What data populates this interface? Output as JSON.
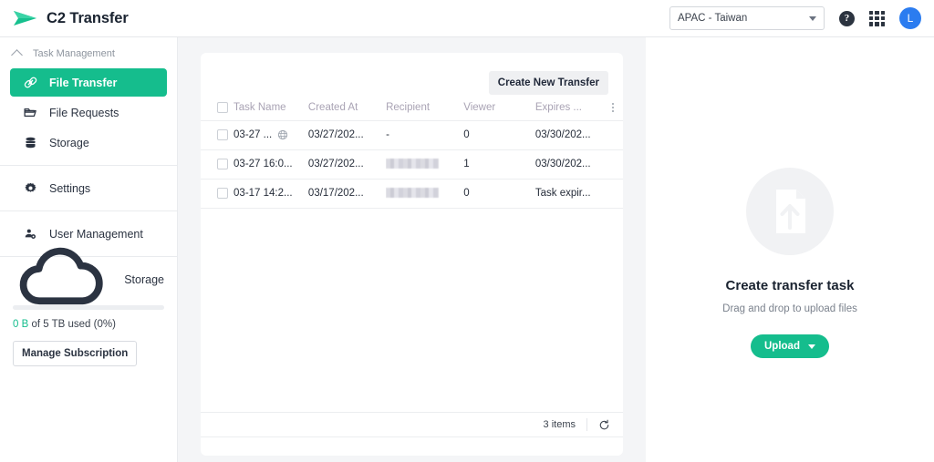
{
  "topbar": {
    "brand_title": "C2 Transfer",
    "logo_icon": "paper-plane-icon",
    "region_value": "APAC - Taiwan",
    "help_glyph": "?",
    "help_icon": "help-circle-icon",
    "apps_icon": "apps-grid-icon",
    "avatar_initial": "L",
    "avatar_color": "#2b7cf0"
  },
  "sidebar": {
    "group_label": "Task Management",
    "group_chevron": "chevron-up-icon",
    "items": [
      {
        "label": "File Transfer",
        "icon": "link-icon",
        "active": true
      },
      {
        "label": "File Requests",
        "icon": "folder-icon",
        "active": false
      },
      {
        "label": "Storage",
        "icon": "database-icon",
        "active": false
      },
      {
        "label": "Settings",
        "icon": "gear-icon",
        "active": false
      },
      {
        "label": "User Management",
        "icon": "user-settings-icon",
        "active": false
      }
    ],
    "storage": {
      "label": "Storage",
      "icon": "cloud-icon",
      "used_value": "0 B",
      "usage_rest": " of 5 TB used (0%)",
      "percent": 0,
      "manage_label": "Manage Subscription"
    },
    "accent_color": "#15bd8d"
  },
  "main": {
    "create_button": "Create New Transfer",
    "columns": [
      "",
      "Task Name",
      "Created At",
      "Recipient",
      "Viewer",
      "Expires ...",
      ""
    ],
    "menu_icon": "kebab-menu-icon",
    "rows": [
      {
        "name": "03-27 ...",
        "name_icon": "globe-icon",
        "has_icon": true,
        "created": "03/27/202...",
        "recipient": "-",
        "recipient_redacted": false,
        "viewer": "0",
        "expires": "03/30/202..."
      },
      {
        "name": "03-27 16:0...",
        "has_icon": false,
        "created": "03/27/202...",
        "recipient": "",
        "recipient_redacted": true,
        "viewer": "1",
        "expires": "03/30/202..."
      },
      {
        "name": "03-17 14:2...",
        "has_icon": false,
        "created": "03/17/202...",
        "recipient": "",
        "recipient_redacted": true,
        "viewer": "0",
        "expires": "Task expir..."
      }
    ],
    "footer": {
      "items_count": "3 items",
      "refresh_icon": "refresh-icon"
    }
  },
  "rightpanel": {
    "upload_icon": "file-upload-icon",
    "title": "Create transfer task",
    "subtitle": "Drag and drop to upload files",
    "upload_button": "Upload",
    "button_color": "#15bd8d"
  }
}
